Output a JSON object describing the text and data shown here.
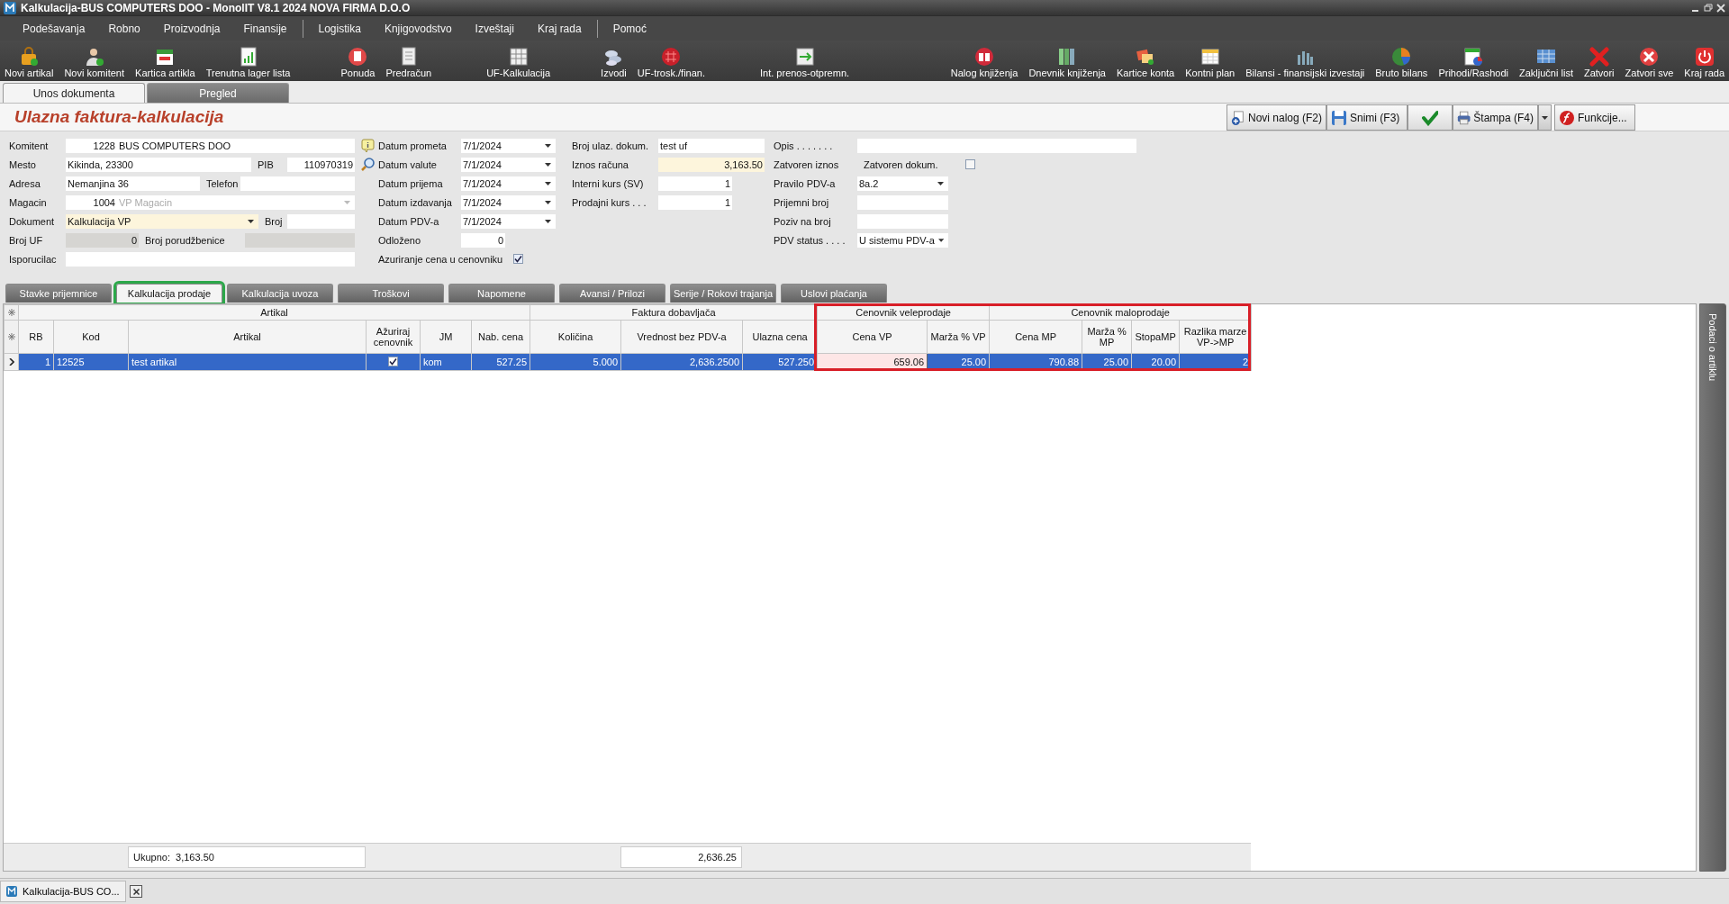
{
  "window": {
    "title": "Kalkulacija-BUS COMPUTERS DOO - MonolIT V8.1 2024 NOVA FIRMA D.O.O"
  },
  "menu": [
    {
      "label": "Podešavanja"
    },
    {
      "label": "Robno"
    },
    {
      "label": "Proizvodnja"
    },
    {
      "label": "Finansije"
    },
    {
      "label": "Logistika"
    },
    {
      "label": "Knjigovodstvo"
    },
    {
      "label": "Izveštaji"
    },
    {
      "label": "Kraj rada"
    },
    {
      "label": "Pomoć"
    }
  ],
  "toolbar": [
    {
      "label": "Novi artikal"
    },
    {
      "label": "Novi komitent"
    },
    {
      "label": "Kartica artikla"
    },
    {
      "label": "Trenutna lager lista"
    },
    {
      "label": "Ponuda"
    },
    {
      "label": "Predračun"
    },
    {
      "label": "UF-Kalkulacija"
    },
    {
      "label": "Izvodi"
    },
    {
      "label": "UF-trosk./finan."
    },
    {
      "label": "Int. prenos-otpremn."
    },
    {
      "label": "Nalog knjiženja"
    },
    {
      "label": "Dnevnik knjiženja"
    },
    {
      "label": "Kartice konta"
    },
    {
      "label": "Kontni plan"
    },
    {
      "label": "Bilansi - finansijski izvestaji"
    },
    {
      "label": "Bruto bilans"
    },
    {
      "label": "Prihodi/Rashodi"
    },
    {
      "label": "Zaključni list"
    },
    {
      "label": "Zatvori"
    },
    {
      "label": "Zatvori sve"
    },
    {
      "label": "Kraj rada"
    }
  ],
  "document_tabs": [
    {
      "label": "Unos dokumenta",
      "selected": true
    },
    {
      "label": "Pregled",
      "selected": false
    }
  ],
  "form_title": "Ulazna faktura-kalkulacija",
  "actions": [
    {
      "kind": "new",
      "label": "Novi nalog (F2)"
    },
    {
      "kind": "save",
      "label": "Snimi (F3)"
    },
    {
      "kind": "confirm"
    },
    {
      "kind": "print",
      "label": "Štampa (F4)"
    },
    {
      "kind": "functions",
      "label": "Funkcije..."
    }
  ],
  "form": {
    "columns": [
      {
        "rows": [
          {
            "label": "Komitent",
            "fields": [
              {
                "kind": "number",
                "value": "1228"
              },
              {
                "kind": "input",
                "value": "BUS COMPUTERS DOO"
              },
              {
                "kind": "info"
              }
            ]
          },
          {
            "label": "Mesto",
            "fields": [
              {
                "kind": "input",
                "value": "Kikinda, 23300"
              },
              {
                "kind": "label",
                "value": "PIB"
              },
              {
                "kind": "number",
                "value": "110970319"
              },
              {
                "kind": "search"
              }
            ]
          },
          {
            "label": "Adresa",
            "fields": [
              {
                "kind": "input",
                "value": "Nemanjina 36"
              },
              {
                "kind": "label",
                "value": "Telefon"
              },
              {
                "kind": "input"
              }
            ]
          },
          {
            "label": "Magacin",
            "fields": [
              {
                "kind": "number",
                "value": "1004"
              },
              {
                "kind": "select",
                "value": "VP Magacin",
                "disabled": true
              }
            ]
          },
          {
            "label": "Dokument",
            "fields": [
              {
                "kind": "select",
                "value": "Kalkulacija VP",
                "highlighted": true
              },
              {
                "kind": "label",
                "value": "Broj"
              },
              {
                "kind": "input"
              }
            ]
          },
          {
            "label": "Broj UF",
            "fields": [
              {
                "kind": "number",
                "value": "0",
                "read_only": true
              },
              {
                "kind": "label",
                "value": "Broj porudžbenice"
              },
              {
                "kind": "input",
                "read_only": true
              }
            ]
          },
          {
            "label": "Isporucilac",
            "fields": [
              {
                "kind": "input"
              },
              {
                "kind": "input"
              }
            ]
          }
        ]
      },
      {
        "rows": [
          {
            "label": "Datum prometa",
            "fields": [
              {
                "kind": "select",
                "value": "7/1/2024"
              }
            ]
          },
          {
            "label": "Datum valute",
            "fields": [
              {
                "kind": "select",
                "value": "7/1/2024"
              }
            ]
          },
          {
            "label": "Datum prijema",
            "fields": [
              {
                "kind": "select",
                "value": "7/1/2024"
              }
            ]
          },
          {
            "label": "Datum izdavanja",
            "fields": [
              {
                "kind": "select",
                "value": "7/1/2024"
              }
            ]
          },
          {
            "label": "Datum PDV-a",
            "fields": [
              {
                "kind": "select",
                "value": "7/1/2024"
              }
            ]
          },
          {
            "label": "Odloženo",
            "fields": [
              {
                "kind": "number",
                "value": "0"
              }
            ]
          },
          {
            "label": "Azuriranje cena u cenovniku",
            "fields": [
              {
                "kind": "checkbox",
                "checked": true
              }
            ]
          }
        ]
      },
      {
        "rows": [
          {
            "label": "Broj ulaz. dokum.",
            "fields": [
              {
                "kind": "input",
                "value": "test uf"
              }
            ]
          },
          {
            "label": "Iznos računa",
            "fields": [
              {
                "kind": "number",
                "value": "3,163.50",
                "highlighted": true
              }
            ]
          },
          {
            "label": "Interni kurs (SV)",
            "fields": [
              {
                "kind": "number",
                "value": "1"
              }
            ]
          },
          {
            "label": "Prodajni kurs . . .",
            "fields": [
              {
                "kind": "number",
                "value": "1"
              }
            ]
          }
        ]
      },
      {
        "rows": [
          {
            "label": "Opis . . . . . . .",
            "fields": [
              {
                "kind": "input"
              }
            ]
          },
          {
            "label": "Zatvoren iznos",
            "fields": [
              {
                "kind": "label",
                "value": "Zatvoren dokum."
              },
              {
                "kind": "checkbox",
                "checked": false
              }
            ]
          },
          {
            "label": "Pravilo PDV-a",
            "fields": [
              {
                "kind": "select",
                "value": "8a.2"
              }
            ]
          },
          {
            "label": "Prijemni broj",
            "fields": [
              {
                "kind": "input"
              }
            ]
          },
          {
            "label": "Poziv na broj",
            "fields": [
              {
                "kind": "input"
              }
            ]
          },
          {
            "label": "PDV status . . . .",
            "fields": [
              {
                "kind": "select",
                "value": "U sistemu PDV-a"
              }
            ]
          }
        ]
      }
    ]
  },
  "detail_tabs": [
    {
      "label": "Stavke  prijemnice",
      "selected": false,
      "highlighted": false
    },
    {
      "label": "Kalkulacija prodaje",
      "selected": true,
      "highlighted": true
    },
    {
      "label": "Kalkulacija uvoza",
      "selected": false,
      "highlighted": false
    },
    {
      "label": "Troškovi",
      "selected": false,
      "highlighted": false
    },
    {
      "label": "Napomene",
      "selected": false,
      "highlighted": false
    },
    {
      "label": "Avansi / Prilozi",
      "selected": false,
      "highlighted": false
    },
    {
      "label": "Serije / Rokovi trajanja",
      "selected": false,
      "highlighted": false
    },
    {
      "label": "Uslovi plaćanja",
      "selected": false,
      "highlighted": false
    }
  ],
  "table": {
    "groups": [
      {
        "label": "Artikal",
        "highlighted": false,
        "columns": [
          {
            "label": "RB",
            "kind": "number"
          },
          {
            "label": "Kod",
            "kind": "text"
          },
          {
            "label": "Artikal",
            "kind": "text",
            "total": "Ukupno:  3,163.50"
          },
          {
            "label": "Ažuriraj cenovnik",
            "kind": "checkbox"
          },
          {
            "label": "JM",
            "kind": "text"
          },
          {
            "label": "Nab. cena",
            "kind": "number"
          }
        ]
      },
      {
        "label": "Faktura dobavljača",
        "highlighted": false,
        "columns": [
          {
            "label": "Količina",
            "kind": "number"
          },
          {
            "label": "Vrednost bez PDV-a",
            "kind": "number",
            "total": "2,636.25"
          },
          {
            "label": "Ulazna cena",
            "kind": "number"
          }
        ]
      },
      {
        "label": "Cenovnik veleprodaje",
        "highlighted": true,
        "columns": [
          {
            "label": "Cena VP",
            "kind": "number"
          },
          {
            "label": "Marža % VP",
            "kind": "number"
          }
        ]
      },
      {
        "label": "Cenovnik maloprodaje",
        "highlighted": true,
        "columns": [
          {
            "label": "Cena MP",
            "kind": "number"
          },
          {
            "label": "Marža % MP",
            "kind": "number"
          },
          {
            "label": "StopaMP",
            "kind": "number"
          },
          {
            "label": "Razlika marze VP->MP",
            "kind": "number"
          }
        ]
      }
    ],
    "rows": [
      {
        "selected": true,
        "cells": [
          {
            "text": "1"
          },
          {
            "text": "12525"
          },
          {
            "text": "test artikal"
          },
          {
            "checked": true
          },
          {
            "text": "kom"
          },
          {
            "text": "527.25"
          },
          {
            "text": "5.000"
          },
          {
            "text": "2,636.2500"
          },
          {
            "text": "527.250"
          },
          {
            "text": "659.06",
            "editing": true
          },
          {
            "text": "25.00"
          },
          {
            "text": "790.88"
          },
          {
            "text": "25.00"
          },
          {
            "text": "20.00"
          },
          {
            "text": "2"
          }
        ]
      }
    ]
  },
  "side_tab": {
    "label": "Podaci o artiklu"
  },
  "taskbar": [
    {
      "label": "Kalkulacija-BUS CO..."
    }
  ]
}
